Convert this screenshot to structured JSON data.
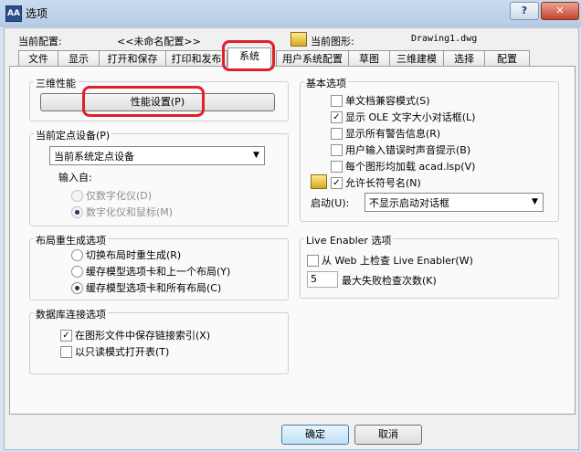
{
  "window": {
    "icon_text": "AA",
    "title": "选项",
    "help": "?",
    "close": "✕"
  },
  "header": {
    "profile_label": "当前配置:",
    "profile_value": "<<未命名配置>>",
    "drawing_label": "当前图形:",
    "drawing_value": "Drawing1.dwg"
  },
  "tabs": [
    "文件",
    "显示",
    "打开和保存",
    "打印和发布",
    "系统",
    "用户系统配置",
    "草图",
    "三维建模",
    "选择",
    "配置"
  ],
  "perf": {
    "title": "三维性能",
    "button": "性能设置(P)"
  },
  "pointing": {
    "title": "当前定点设备(P)",
    "select_value": "当前系统定点设备",
    "accept_label": "输入自:",
    "options": [
      "仅数字化仪(D)",
      "数字化仪和鼠标(M)"
    ]
  },
  "regen": {
    "title": "布局重生成选项",
    "options": [
      "切换布局时重生成(R)",
      "缓存模型选项卡和上一个布局(Y)",
      "缓存模型选项卡和所有布局(C)"
    ]
  },
  "db": {
    "title": "数据库连接选项",
    "options": [
      "在图形文件中保存链接索引(X)",
      "以只读模式打开表(T)"
    ]
  },
  "general": {
    "title": "基本选项",
    "options": [
      {
        "label": "单文档兼容模式(S)",
        "checked": false
      },
      {
        "label": "显示 OLE 文字大小对话框(L)",
        "checked": true
      },
      {
        "label": "显示所有警告信息(R)",
        "checked": false
      },
      {
        "label": "用户输入错误时声音提示(B)",
        "checked": false
      },
      {
        "label": "每个图形均加载 acad.lsp(V)",
        "checked": false
      },
      {
        "label": "允许长符号名(N)",
        "checked": true
      }
    ],
    "startup_label": "启动(U):",
    "startup_value": "不显示启动对话框"
  },
  "live": {
    "title": "Live Enabler 选项",
    "check_label": "从 Web 上检查 Live Enabler(W)",
    "max_value": "5",
    "max_label": "最大失败检查次数(K)"
  },
  "footer": {
    "ok": "确定",
    "cancel": "取消"
  },
  "check_mark": "✓",
  "dropdown_arrow": "▼"
}
